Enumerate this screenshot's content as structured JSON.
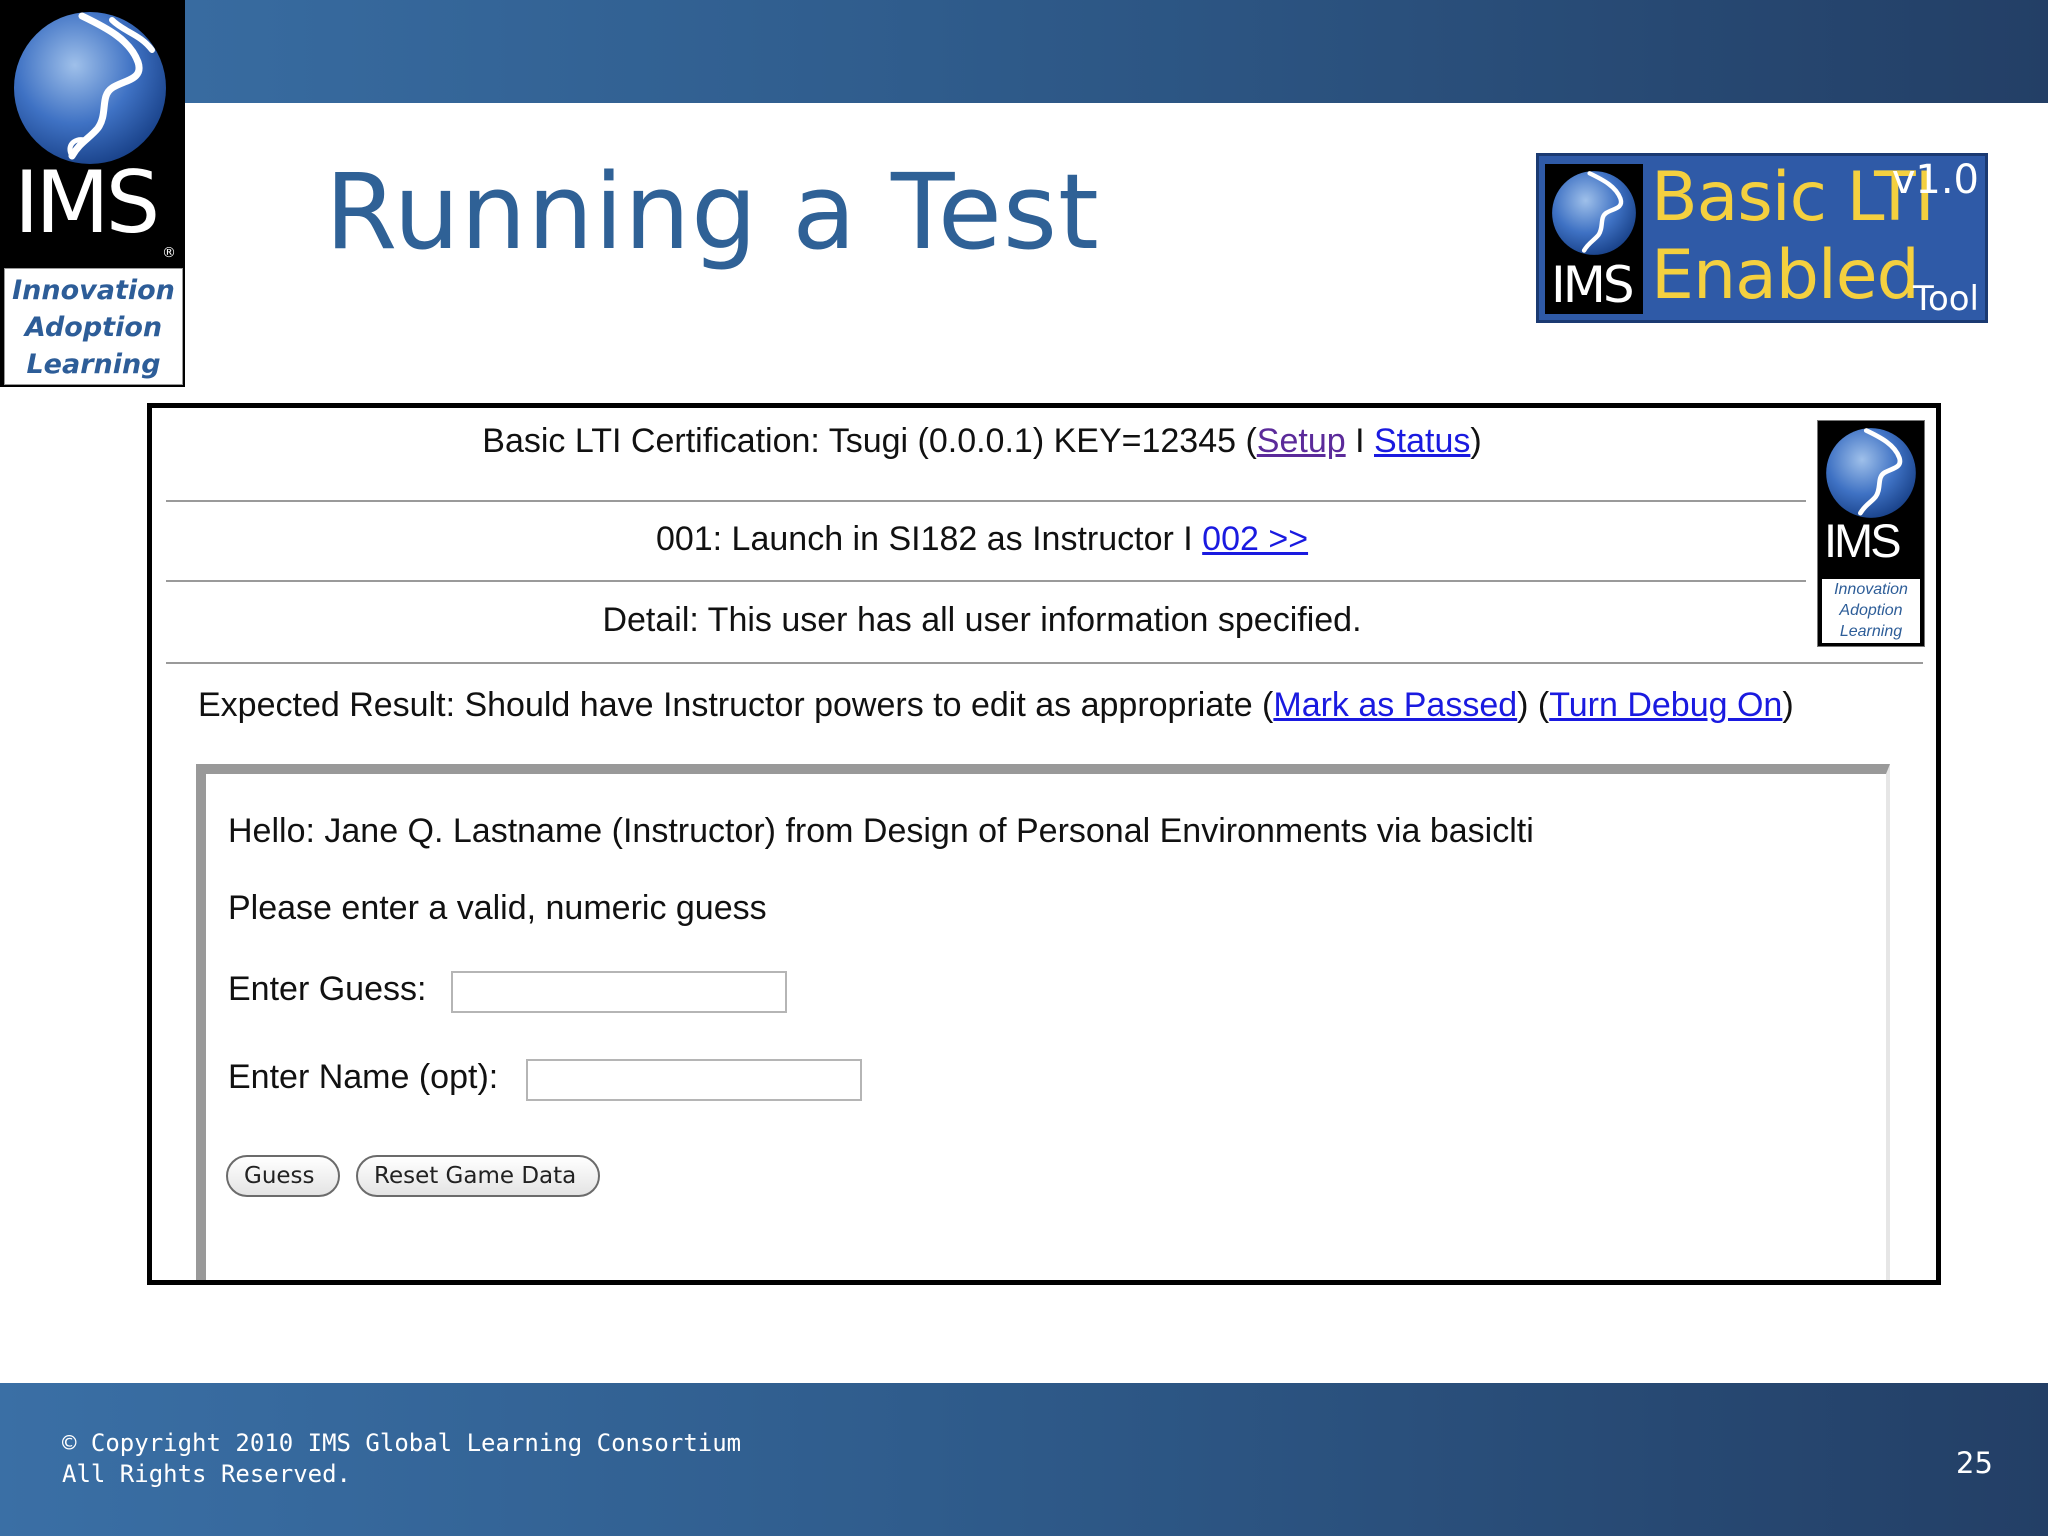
{
  "slide": {
    "title": "Running a Test",
    "logo": {
      "word": "IMS",
      "tagline": [
        "Innovation",
        "Adoption",
        "Learning"
      ]
    },
    "badge": {
      "line1": "Basic LTI",
      "line2": "Enabled",
      "version": "v1.0",
      "tool": "Tool",
      "word": "IMS"
    },
    "footer": {
      "copyright": "© Copyright 2010 IMS Global Learning Consortium",
      "rights": "All Rights Reserved.",
      "page_number": "25"
    }
  },
  "screenshot": {
    "header": {
      "prefix": "Basic LTI Certification: Tsugi (0.0.0.1) KEY=12345 (",
      "setup_link": "Setup",
      "separator": " I ",
      "status_link": "Status",
      "suffix": ")"
    },
    "nav": {
      "text": "001: Launch in SI182 as Instructor I ",
      "next_link": "002 >>"
    },
    "detail": "Detail: This user has all user information specified.",
    "expected": {
      "prefix": "Expected Result: Should have Instructor powers to edit as appropriate (",
      "mark_passed_link": "Mark as Passed",
      "middle": ") (",
      "debug_link": "Turn Debug On",
      "suffix": ")"
    },
    "inner_logo": {
      "word": "IMS",
      "tagline": [
        "Innovation",
        "Adoption",
        "Learning"
      ]
    },
    "tool": {
      "hello": "Hello: Jane Q. Lastname (Instructor) from Design of Personal Environments via basiclti",
      "prompt": "Please enter a valid, numeric guess",
      "guess_label": "Enter Guess:",
      "guess_value": "",
      "name_label": "Enter Name (opt):",
      "name_value": "",
      "guess_button": "Guess",
      "reset_button": "Reset Game Data"
    }
  },
  "colors": {
    "band": "#2f5c8c",
    "title": "#2f6196",
    "badge_bg": "#2f5aa7",
    "badge_text": "#f4d03f",
    "link": "#1a1ae0",
    "visited_link": "#5b2a9a"
  }
}
